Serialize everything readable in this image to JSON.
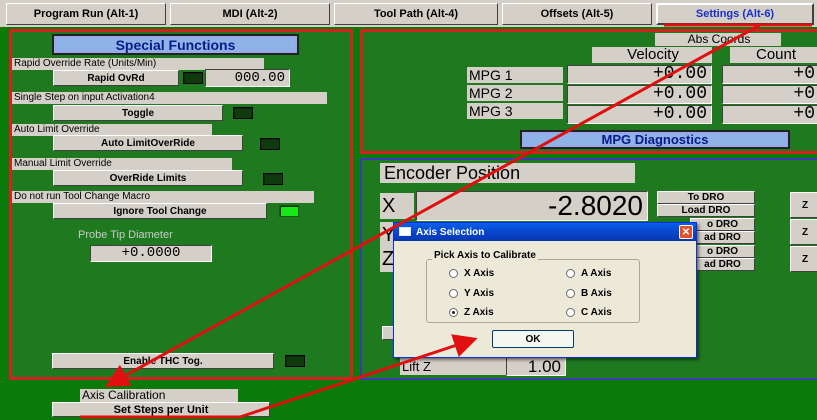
{
  "tabs": [
    {
      "label": "Program Run (Alt-1)"
    },
    {
      "label": "MDI (Alt-2)"
    },
    {
      "label": "Tool Path (Alt-4)"
    },
    {
      "label": "Offsets (Alt-5)"
    },
    {
      "label": "Settings (Alt-6)",
      "active": true
    }
  ],
  "special_functions": {
    "title": "Special Functions",
    "rapid_override_label": "Rapid Override Rate (Units/Min)",
    "rapid_ovrd_button": "Rapid OvRd",
    "rapid_value": "000.00",
    "single_step_label": "Single Step on input Activation4",
    "toggle_button": "Toggle",
    "auto_limit_label": "Auto Limit Override",
    "auto_limit_button": "Auto LimitOverRide",
    "manual_limit_label": "Manual Limit Override",
    "override_limits_button": "OverRide Limits",
    "no_tool_change_label": "Do not run Tool Change Macro",
    "ignore_tool_change_button": "Ignore Tool Change",
    "probe_tip_label": "Probe Tip Diameter",
    "probe_tip_value": "+0.0000",
    "enable_thc_button": "Enable THC Tog."
  },
  "mpg": {
    "abs_coords_label": "Abs Coords",
    "velocity_header": "Velocity",
    "count_header": "Count",
    "rows": [
      {
        "label": "MPG 1",
        "velocity": "+0.00",
        "count": "+0"
      },
      {
        "label": "MPG 2",
        "velocity": "+0.00",
        "count": "+0"
      },
      {
        "label": "MPG 3",
        "velocity": "+0.00",
        "count": "+0"
      }
    ],
    "diagnostics_title": "MPG Diagnostics"
  },
  "encoder": {
    "title": "Encoder Position",
    "x_label": "X",
    "x_value": "-2.8020",
    "y_label": "Y",
    "z_label": "Z",
    "to_dro": "To DRO",
    "load_dro": "Load DRO",
    "load_dro_partial": "ad DRO",
    "to_dro_partial": "o DRO",
    "zero_partial": "Z",
    "lift_z_label": "Lift Z",
    "lift_z_value": "1.00"
  },
  "axis_calibration": {
    "label": "Axis Calibration",
    "button": "Set Steps per Unit"
  },
  "dialog": {
    "title": "Axis Selection",
    "close_glyph": "✕",
    "group_label": "Pick Axis to Calibrate",
    "options": [
      {
        "label": "X Axis",
        "selected": false
      },
      {
        "label": "A Axis",
        "selected": false
      },
      {
        "label": "Y Axis",
        "selected": false
      },
      {
        "label": "B Axis",
        "selected": false
      },
      {
        "label": "Z Axis",
        "selected": true
      },
      {
        "label": "C Axis",
        "selected": false
      }
    ],
    "ok_button": "OK"
  },
  "colors": {
    "background": "#0a7a0a",
    "panel": "#1f7a1f",
    "annotation_red": "#e01010",
    "led_on": "#18e818"
  }
}
